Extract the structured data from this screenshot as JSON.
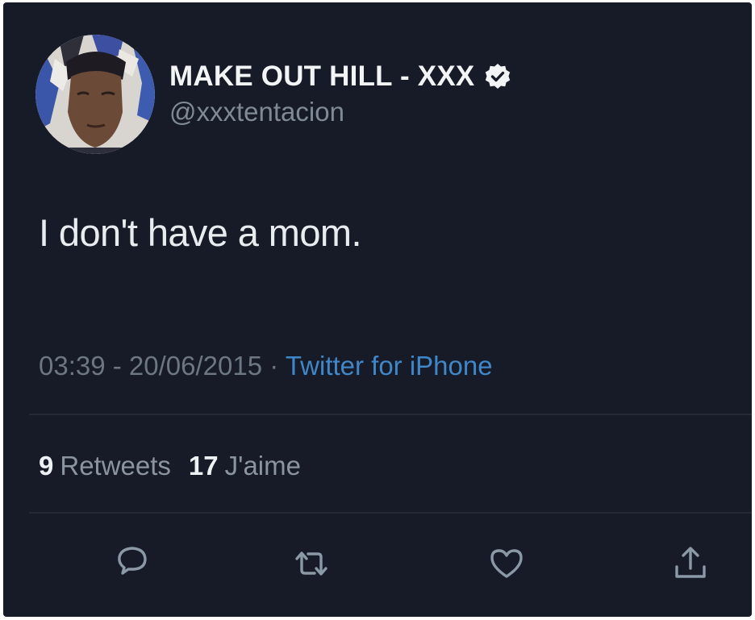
{
  "tweet": {
    "display_name": "MAKE OUT HILL - XXX",
    "handle": "@xxxtentacion",
    "verified": true,
    "text": "I don't have a mom.",
    "time": "03:39 - 20/06/2015",
    "separator": " · ",
    "source": "Twitter for iPhone",
    "retweets_count": "9",
    "retweets_label": "Retweets",
    "likes_count": "17",
    "likes_label": "J'aime"
  },
  "icons": {
    "reply": "reply-icon",
    "retweet": "retweet-icon",
    "like": "heart-icon",
    "share": "share-icon",
    "verified": "verified-badge-icon"
  },
  "colors": {
    "background": "#161b27",
    "accent_link": "#3f87c9",
    "muted_text": "#6c7782",
    "icon": "#8b98a5"
  }
}
